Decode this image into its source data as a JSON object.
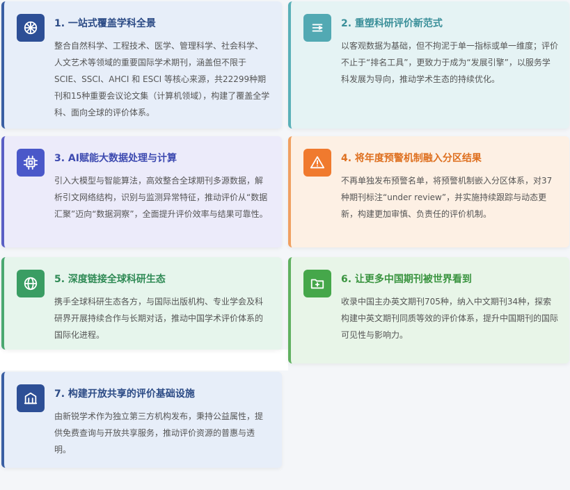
{
  "cards": [
    {
      "title": "1. 一站式覆盖学科全景",
      "body": "整合自然科学、工程技术、医学、管理科学、社会科学、人文艺术等领域的重要国际学术期刊，涵盖但不限于 SCIE、SSCI、AHCI 和 ESCI 等核心来源，共22299种期刊和15种重要会议论文集（计算机领域），构建了覆盖全学科、面向全球的评价体系。",
      "icon": "compass-icon",
      "color": "#2d4f96"
    },
    {
      "title": "2. 重塑科研评价新范式",
      "body": "以客观数据为基础，但不拘泥于单一指标或单一维度；评价不止于“排名工具”，更致力于成为“发展引擎”，以服务学科发展为导向，推动学术生态的持续优化。",
      "icon": "route-icon",
      "color": "#52a9b3"
    },
    {
      "title": "3. AI赋能大数据处理与计算",
      "body": "引入大模型与智能算法，高效整合全球期刊多源数据，解析引文网络结构，识别与监测异常特征，推动评价从“数据汇聚”迈向“数据洞察”，全面提升评价效率与结果可靠性。",
      "icon": "chip-icon",
      "color": "#4a58c9"
    },
    {
      "title": "4. 将年度预警机制融入分区结果",
      "body": "不再单独发布预警名单，将预警机制嵌入分区体系，对37种期刊标注“under review”，并实施持续跟踪与动态更新，构建更加审慎、负责任的评价机制。",
      "icon": "warning-icon",
      "color": "#f07a2e"
    },
    {
      "title": "5. 深度链接全球科研生态",
      "body": "携手全球科研生态各方，与国际出版机构、专业学会及科研界开展持续合作与长期对话，推动中国学术评价体系的国际化进程。",
      "icon": "globe-icon",
      "color": "#3a9d63"
    },
    {
      "title": "6. 让更多中国期刊被世界看到",
      "body": "收录中国主办英文期刊705种，纳入中文期刊34种，探索构建中英文期刊同质等效的评价体系，提升中国期刊的国际可见性与影响力。",
      "icon": "folder-plus-icon",
      "color": "#45a74a"
    },
    {
      "title": "7. 构建开放共享的评价基础设施",
      "body": "由新锐学术作为独立第三方机构发布，秉持公益属性，提供免费查询与开放共享服务，推动评价资源的普惠与透明。",
      "icon": "building-icon",
      "color": "#2d4f96"
    }
  ]
}
